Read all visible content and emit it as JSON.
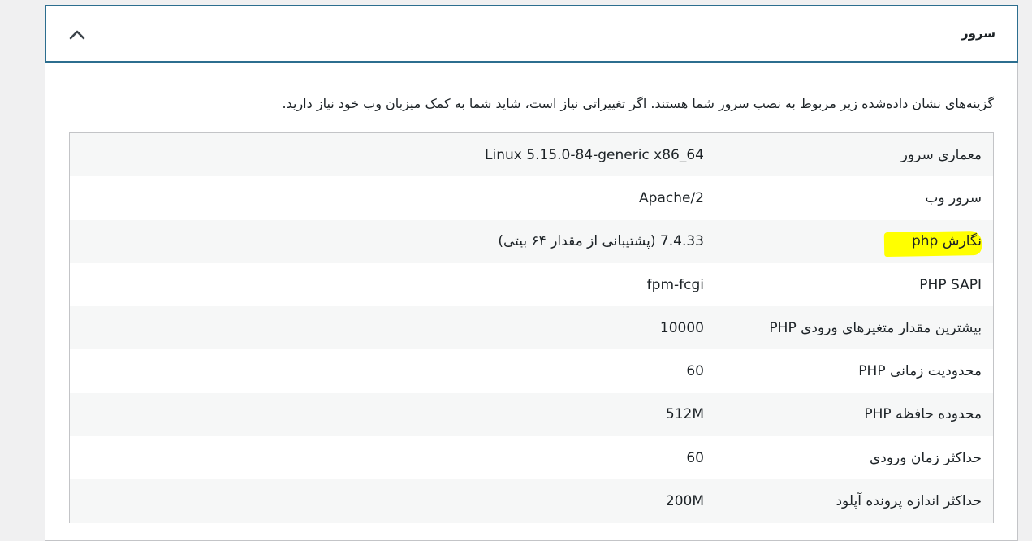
{
  "panel": {
    "title": "سرور",
    "toggle_icon": "chevron-up-icon",
    "accent_color": "#2c6e8f"
  },
  "intro": "گزینه‌های نشان داده‌شده زیر مربوط به نصب سرور شما هستند. اگر تغییراتی نیاز است، شاید شما به کمک میزبان وب خود نیاز دارید.",
  "highlight_color": "#ffff00",
  "rows": [
    {
      "label": "معماری سرور",
      "value": "Linux 5.15.0-84-generic x86_64"
    },
    {
      "label": "سرور وب",
      "value": "Apache/2"
    },
    {
      "label": "نگارش php",
      "value": "7.4.33 (پشتیبانی از مقدار ۶۴ بیتی)",
      "highlighted": true
    },
    {
      "label": "PHP SAPI",
      "value": "fpm-fcgi"
    },
    {
      "label": "بیشترین مقدار متغیرهای ورودی PHP",
      "value": "10000"
    },
    {
      "label": "محدودیت زمانی PHP",
      "value": "60"
    },
    {
      "label": "محدوده حافظه PHP",
      "value": "512M"
    },
    {
      "label": "حداکثر زمان ورودی",
      "value": "60"
    },
    {
      "label": "حداکثر اندازه پرونده آپلود",
      "value": "200M"
    }
  ]
}
